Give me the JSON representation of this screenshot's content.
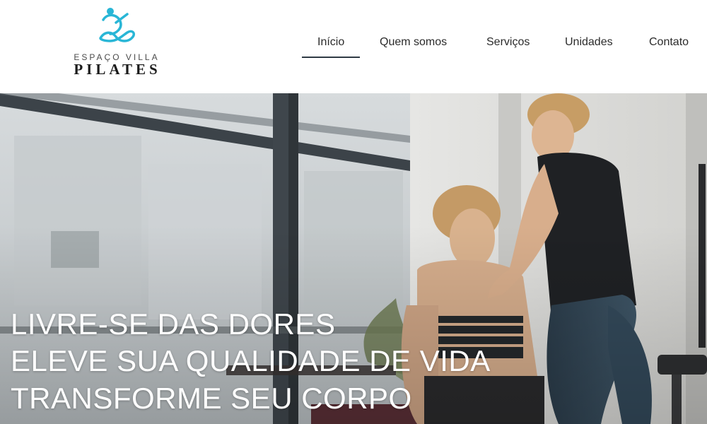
{
  "brand": {
    "top_text": "ESPAÇO VILLA",
    "main_text": "PILATES",
    "accent_color": "#29b6d6"
  },
  "nav": {
    "items": [
      {
        "label": "Início",
        "active": true
      },
      {
        "label": "Quem somos",
        "active": false
      },
      {
        "label": "Serviços",
        "active": false
      },
      {
        "label": "Unidades",
        "active": false
      },
      {
        "label": "Contato",
        "active": false
      }
    ]
  },
  "hero": {
    "lines": [
      "LIVRE-SE DAS DORES",
      "ELEVE SUA QUALIDADE DE VIDA",
      "TRANSFORME SEU CORPO"
    ]
  }
}
